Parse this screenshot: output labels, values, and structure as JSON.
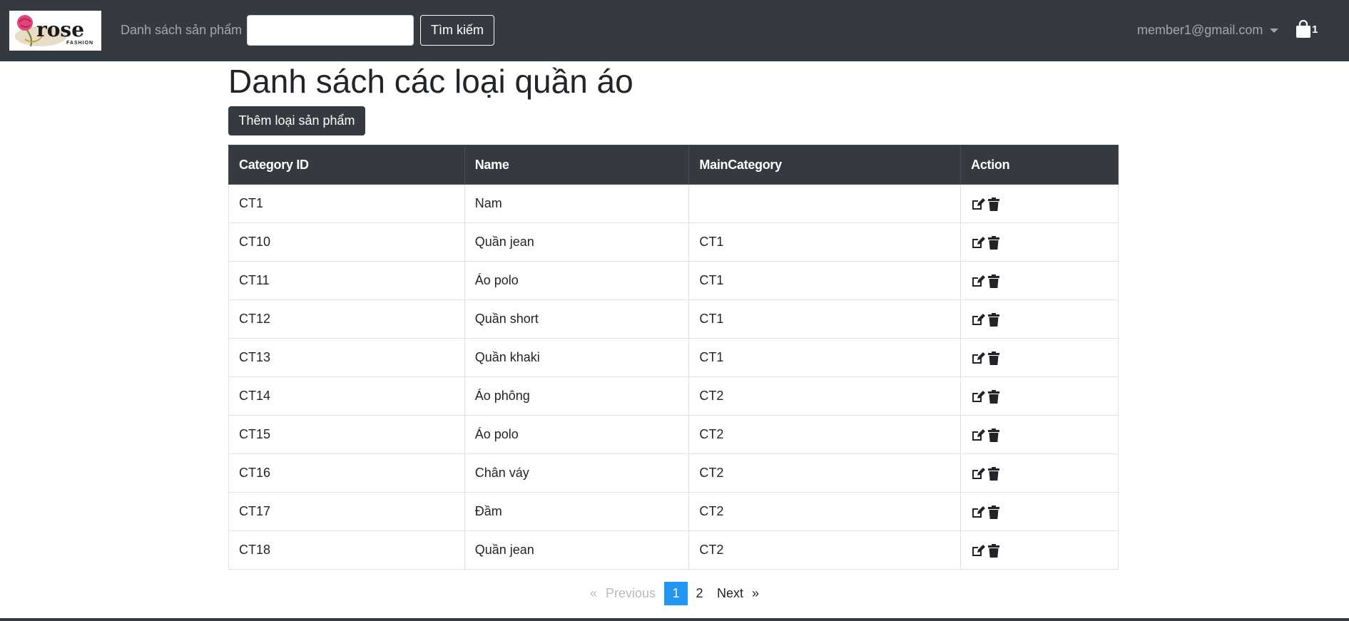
{
  "navbar": {
    "logo_text": "rose",
    "logo_subtext": "FASHION",
    "products_link": "Danh sách sản phẩm",
    "search_value": "",
    "search_button": "Tìm kiếm",
    "user_email": "member1@gmail.com",
    "cart_count": "1",
    "cart_icon": "shopping-bag-icon",
    "caret_icon": "chevron-down-icon"
  },
  "main": {
    "title": "Danh sách các loại quần áo",
    "add_button": "Thêm loại sản phẩm"
  },
  "table": {
    "headers": [
      "Category ID",
      "Name",
      "MainCategory",
      "Action"
    ],
    "rows": [
      {
        "id": "CT1",
        "name": "Nam",
        "main": ""
      },
      {
        "id": "CT10",
        "name": "Quần jean",
        "main": "CT1"
      },
      {
        "id": "CT11",
        "name": "Áo polo",
        "main": "CT1"
      },
      {
        "id": "CT12",
        "name": "Quần short",
        "main": "CT1"
      },
      {
        "id": "CT13",
        "name": "Quần khaki",
        "main": "CT1"
      },
      {
        "id": "CT14",
        "name": "Áo phông",
        "main": "CT2"
      },
      {
        "id": "CT15",
        "name": "Áo polo",
        "main": "CT2"
      },
      {
        "id": "CT16",
        "name": "Chân váy",
        "main": "CT2"
      },
      {
        "id": "CT17",
        "name": "Đầm",
        "main": "CT2"
      },
      {
        "id": "CT18",
        "name": "Quần jean",
        "main": "CT2"
      }
    ],
    "action_icons": [
      "edit-icon",
      "trash-icon"
    ]
  },
  "pagination": {
    "prev_arrow": "«",
    "prev_label": "Previous",
    "pages": [
      "1",
      "2"
    ],
    "active_page": "1",
    "next_label": "Next",
    "next_arrow": "»"
  },
  "colors": {
    "navbar_bg": "#343a40",
    "active_page": "#2196f3",
    "logo_rose": "#e0457b"
  }
}
